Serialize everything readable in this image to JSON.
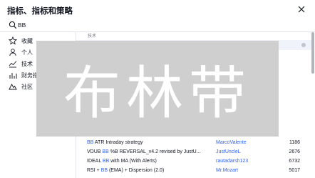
{
  "header": {
    "title": "指标、指标和策略"
  },
  "search": {
    "value": "BB"
  },
  "sidebar": {
    "items": [
      {
        "label": "收藏",
        "icon": "star-icon"
      },
      {
        "label": "个人",
        "icon": "user-icon"
      },
      {
        "label": "技术",
        "icon": "chart-line-icon"
      },
      {
        "label": "财务指",
        "icon": "bar-chart-icon"
      },
      {
        "label": "社区",
        "icon": "community-icon"
      }
    ]
  },
  "main": {
    "section_label": "技术",
    "rows": [
      {
        "highlight": "BB",
        "name_rest": " ATR Intraday strategy",
        "author": "MarcoValente",
        "likes": "1186"
      },
      {
        "prefix": "VDUB ",
        "highlight": "BB",
        "name_rest": " %B REVERSAL_v4.2 revised by JustU...",
        "author": "JustUncleL",
        "likes": "2676"
      },
      {
        "prefix": "IDEAL ",
        "highlight": "BB",
        "name_rest": " with MA (With Alerts)",
        "author": "rautadarsh123",
        "likes": "6732"
      },
      {
        "prefix": "RSI + ",
        "highlight": "BB",
        "name_rest": " (EMA) + Dispersion (2.0)",
        "author": "Mr.Mozart",
        "likes": "5017"
      }
    ]
  },
  "overlay": {
    "text": "布林带"
  },
  "colors": {
    "accent": "#2962ff",
    "overlay": "#cfcfcf"
  }
}
